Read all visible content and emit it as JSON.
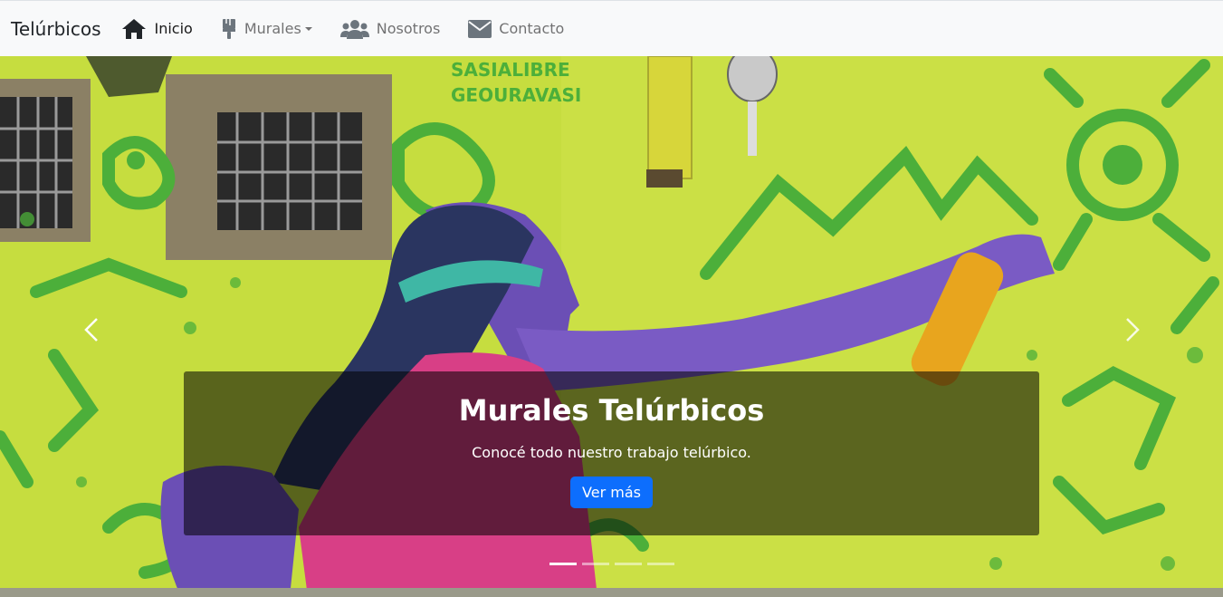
{
  "nav": {
    "brand": "Telúrbicos",
    "items": [
      {
        "label": "Inicio",
        "icon": "home-icon",
        "active": true
      },
      {
        "label": "Murales",
        "icon": "paint-brush-icon",
        "dropdown": true
      },
      {
        "label": "Nosotros",
        "icon": "users-icon"
      },
      {
        "label": "Contacto",
        "icon": "envelope-icon"
      }
    ]
  },
  "carousel": {
    "mural_text": [
      "SASIALIBRE",
      "GEOURAVASI"
    ],
    "caption_title": "Murales Telúrbicos",
    "caption_text": "Conocé todo nuestro trabajo telúrbico.",
    "button_label": "Ver más",
    "slides": 4,
    "active_slide": 1
  },
  "colors": {
    "primary": "#0d6efd",
    "navbar_bg": "#f8f9fa",
    "wall_yellow": "#c6dd3f",
    "mural_green": "#4caf3a",
    "figure_purple": "#6b4fb5"
  }
}
